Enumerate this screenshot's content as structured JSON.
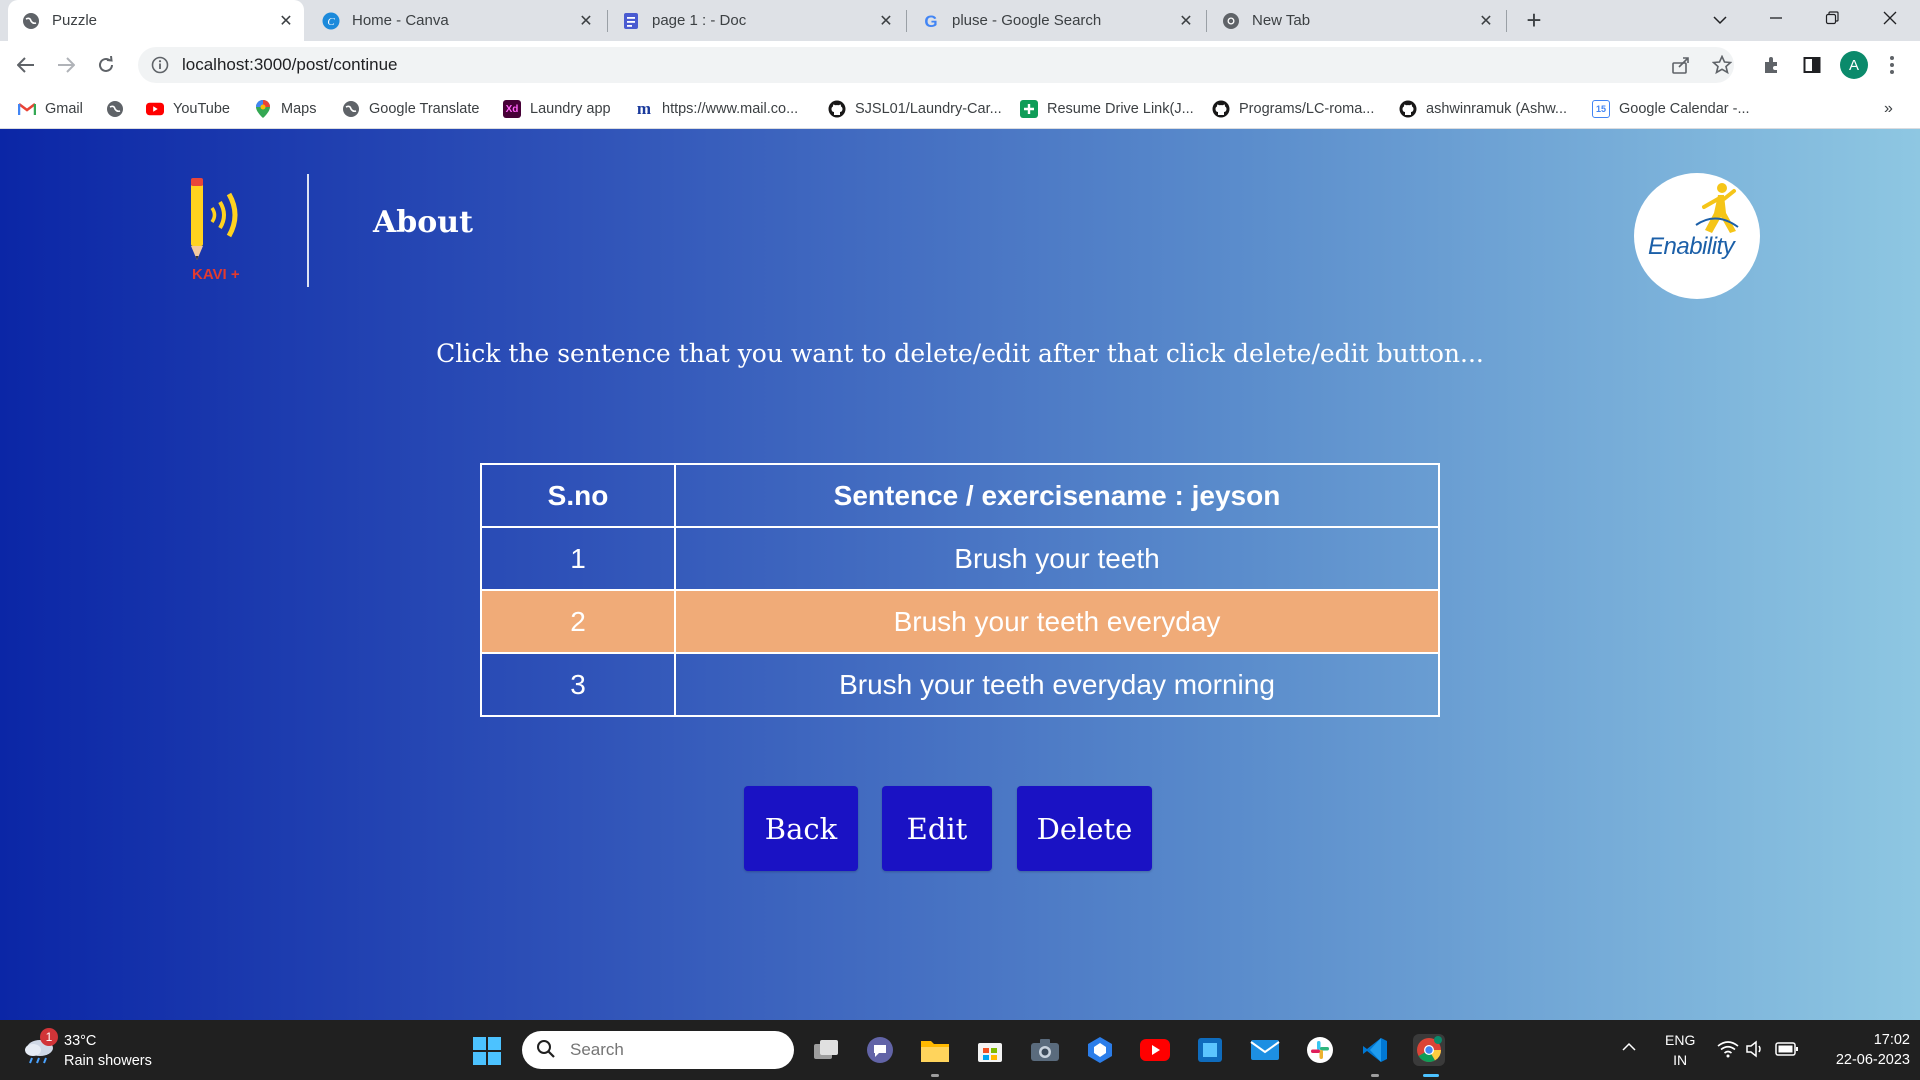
{
  "browser": {
    "tabs": [
      {
        "title": "Puzzle",
        "active": true,
        "icon": "globe-icon"
      },
      {
        "title": "Home - Canva",
        "active": false,
        "icon": "canva-icon"
      },
      {
        "title": "page 1 : - Doc",
        "active": false,
        "icon": "doc-icon"
      },
      {
        "title": "pluse - Google Search",
        "active": false,
        "icon": "google-icon"
      },
      {
        "title": "New Tab",
        "active": false,
        "icon": "chrome-icon"
      }
    ],
    "close_glyph": "✕",
    "newtab_glyph": "+",
    "url": "localhost:3000/post/continue",
    "profile_initial": "A",
    "bookmarks": [
      {
        "label": "Gmail",
        "icon": "gmail-icon"
      },
      {
        "label": "",
        "icon": "globe-icon"
      },
      {
        "label": "YouTube",
        "icon": "youtube-icon"
      },
      {
        "label": "Maps",
        "icon": "maps-icon"
      },
      {
        "label": "Google Translate",
        "icon": "globe-icon"
      },
      {
        "label": "Laundry app",
        "icon": "xd-icon"
      },
      {
        "label": "https://www.mail.co...",
        "icon": "mail-m-icon"
      },
      {
        "label": "SJSL01/Laundry-Car...",
        "icon": "github-icon"
      },
      {
        "label": "Resume Drive Link(J...",
        "icon": "sheets-icon"
      },
      {
        "label": "Programs/LC-roma...",
        "icon": "github-icon"
      },
      {
        "label": "ashwinramuk (Ashw...",
        "icon": "github-icon"
      },
      {
        "label": "Google Calendar -...",
        "icon": "calendar-icon"
      }
    ],
    "bookmarks_overflow": "»"
  },
  "app": {
    "logo_text": "KAVI +",
    "nav_about": "About",
    "partner_logo_text": "Enability",
    "instruction": "Click the sentence that you want to delete/edit after that click delete/edit button...",
    "table": {
      "headers": [
        "S.no",
        "Sentence / exercisename : jeyson"
      ],
      "rows": [
        {
          "sno": "1",
          "sentence": "Brush your teeth",
          "selected": false
        },
        {
          "sno": "2",
          "sentence": "Brush your teeth everyday",
          "selected": true
        },
        {
          "sno": "3",
          "sentence": "Brush your teeth everyday morning",
          "selected": false
        }
      ]
    },
    "buttons": {
      "back": "Back",
      "edit": "Edit",
      "delete": "Delete"
    },
    "colors": {
      "selected_row": "#f0ab78",
      "button_bg": "#1a12c4"
    }
  },
  "taskbar": {
    "weather_badge": "1",
    "temperature": "33°C",
    "weather_desc": "Rain showers",
    "search_placeholder": "Search",
    "lang_top": "ENG",
    "lang_bottom": "IN",
    "time": "17:02",
    "date": "22-06-2023"
  }
}
